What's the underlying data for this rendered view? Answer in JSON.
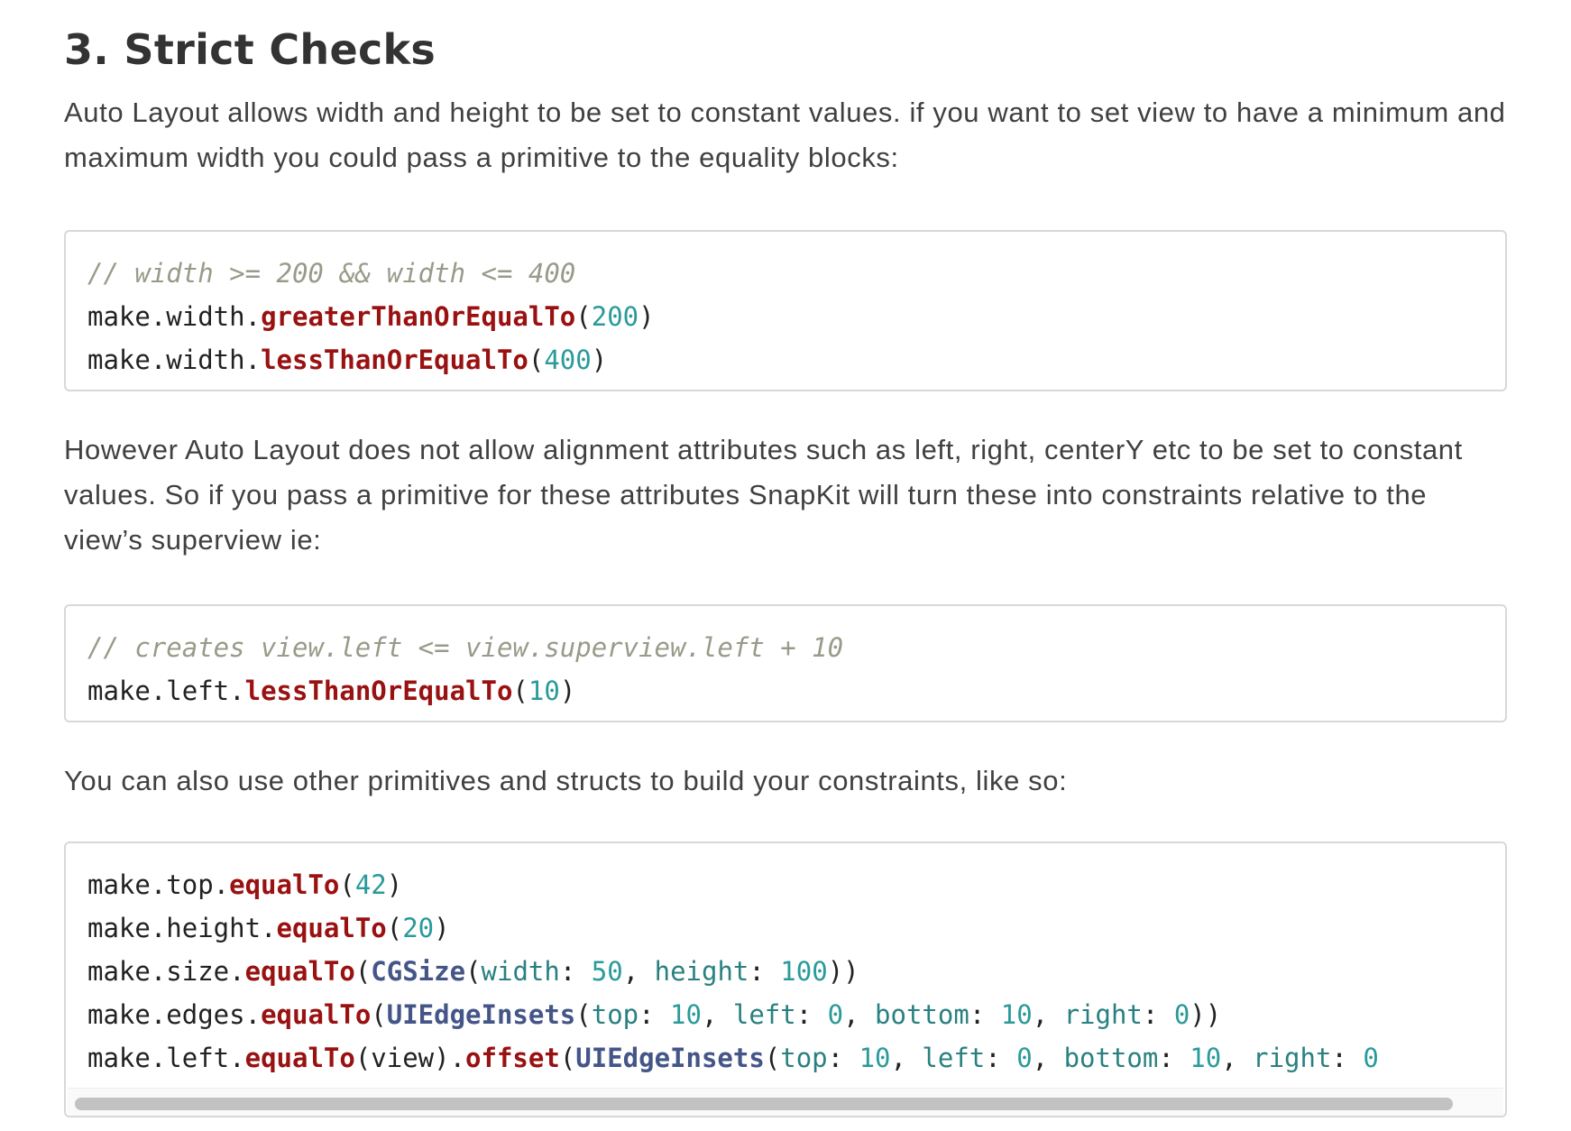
{
  "section": {
    "title": "3. Strict Checks"
  },
  "paragraphs": [
    "Auto Layout allows width and height to be set to constant values. if you want to set view to have a minimum and maximum width you could pass a primitive to the equality blocks:",
    "However Auto Layout does not allow alignment attributes such as left, right, centerY etc to be set to constant values. So if you pass a primitive for these attributes SnapKit will turn these into constraints relative to the view’s superview ie:",
    "You can also use other primitives and structs to build your constraints, like so:"
  ],
  "code_blocks": [
    {
      "lines": [
        [
          {
            "t": "comment",
            "v": "// width >= 200 && width <= 400"
          }
        ],
        [
          {
            "t": "plain",
            "v": "make.width."
          },
          {
            "t": "fn",
            "v": "greaterThanOrEqualTo"
          },
          {
            "t": "plain",
            "v": "("
          },
          {
            "t": "num",
            "v": "200"
          },
          {
            "t": "plain",
            "v": ")"
          }
        ],
        [
          {
            "t": "plain",
            "v": "make.width."
          },
          {
            "t": "fn",
            "v": "lessThanOrEqualTo"
          },
          {
            "t": "plain",
            "v": "("
          },
          {
            "t": "num",
            "v": "400"
          },
          {
            "t": "plain",
            "v": ")"
          }
        ]
      ]
    },
    {
      "lines": [
        [
          {
            "t": "comment",
            "v": "// creates view.left <= view.superview.left + 10"
          }
        ],
        [
          {
            "t": "plain",
            "v": "make.left."
          },
          {
            "t": "fn",
            "v": "lessThanOrEqualTo"
          },
          {
            "t": "plain",
            "v": "("
          },
          {
            "t": "num",
            "v": "10"
          },
          {
            "t": "plain",
            "v": ")"
          }
        ]
      ]
    },
    {
      "lines": [
        [
          {
            "t": "plain",
            "v": "make.top."
          },
          {
            "t": "fn",
            "v": "equalTo"
          },
          {
            "t": "plain",
            "v": "("
          },
          {
            "t": "num",
            "v": "42"
          },
          {
            "t": "plain",
            "v": ")"
          }
        ],
        [
          {
            "t": "plain",
            "v": "make.height."
          },
          {
            "t": "fn",
            "v": "equalTo"
          },
          {
            "t": "plain",
            "v": "("
          },
          {
            "t": "num",
            "v": "20"
          },
          {
            "t": "plain",
            "v": ")"
          }
        ],
        [
          {
            "t": "plain",
            "v": "make.size."
          },
          {
            "t": "fn",
            "v": "equalTo"
          },
          {
            "t": "plain",
            "v": "("
          },
          {
            "t": "type",
            "v": "CGSize"
          },
          {
            "t": "plain",
            "v": "("
          },
          {
            "t": "label",
            "v": "width"
          },
          {
            "t": "plain",
            "v": ": "
          },
          {
            "t": "num",
            "v": "50"
          },
          {
            "t": "plain",
            "v": ", "
          },
          {
            "t": "label",
            "v": "height"
          },
          {
            "t": "plain",
            "v": ": "
          },
          {
            "t": "num",
            "v": "100"
          },
          {
            "t": "plain",
            "v": "))"
          }
        ],
        [
          {
            "t": "plain",
            "v": "make.edges."
          },
          {
            "t": "fn",
            "v": "equalTo"
          },
          {
            "t": "plain",
            "v": "("
          },
          {
            "t": "type",
            "v": "UIEdgeInsets"
          },
          {
            "t": "plain",
            "v": "("
          },
          {
            "t": "label",
            "v": "top"
          },
          {
            "t": "plain",
            "v": ": "
          },
          {
            "t": "num",
            "v": "10"
          },
          {
            "t": "plain",
            "v": ", "
          },
          {
            "t": "label",
            "v": "left"
          },
          {
            "t": "plain",
            "v": ": "
          },
          {
            "t": "num",
            "v": "0"
          },
          {
            "t": "plain",
            "v": ", "
          },
          {
            "t": "label",
            "v": "bottom"
          },
          {
            "t": "plain",
            "v": ": "
          },
          {
            "t": "num",
            "v": "10"
          },
          {
            "t": "plain",
            "v": ", "
          },
          {
            "t": "label",
            "v": "right"
          },
          {
            "t": "plain",
            "v": ": "
          },
          {
            "t": "num",
            "v": "0"
          },
          {
            "t": "plain",
            "v": "))"
          }
        ],
        [
          {
            "t": "plain",
            "v": "make.left."
          },
          {
            "t": "fn",
            "v": "equalTo"
          },
          {
            "t": "plain",
            "v": "(view)."
          },
          {
            "t": "fn",
            "v": "offset"
          },
          {
            "t": "plain",
            "v": "("
          },
          {
            "t": "type",
            "v": "UIEdgeInsets"
          },
          {
            "t": "plain",
            "v": "("
          },
          {
            "t": "label",
            "v": "top"
          },
          {
            "t": "plain",
            "v": ": "
          },
          {
            "t": "num",
            "v": "10"
          },
          {
            "t": "plain",
            "v": ", "
          },
          {
            "t": "label",
            "v": "left"
          },
          {
            "t": "plain",
            "v": ": "
          },
          {
            "t": "num",
            "v": "0"
          },
          {
            "t": "plain",
            "v": ", "
          },
          {
            "t": "label",
            "v": "bottom"
          },
          {
            "t": "plain",
            "v": ": "
          },
          {
            "t": "num",
            "v": "10"
          },
          {
            "t": "plain",
            "v": ", "
          },
          {
            "t": "label",
            "v": "right"
          },
          {
            "t": "plain",
            "v": ": "
          },
          {
            "t": "num",
            "v": "0"
          }
        ]
      ]
    }
  ],
  "colors": {
    "comment": "#9a9a8a",
    "function": "#991111",
    "number": "#2a9a9a",
    "type": "#445588",
    "label": "#2a8080",
    "border": "#d8d8d8",
    "scrollbar_thumb": "#c2c2c2"
  }
}
